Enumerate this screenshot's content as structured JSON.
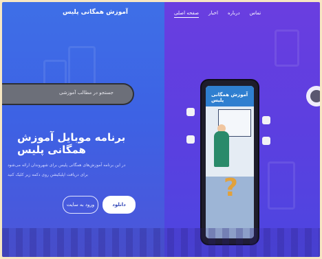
{
  "header": {
    "title": "آموزش همگانی پلیس"
  },
  "nav": {
    "items": [
      {
        "label": "صفحه اصلی",
        "active": true
      },
      {
        "label": "اخبار"
      },
      {
        "label": "درباره"
      },
      {
        "label": "تماس"
      }
    ]
  },
  "search": {
    "placeholder": "جستجو در مطالب آموزشی"
  },
  "hero": {
    "headline": "برنامه موبایل آموزش همگانی پلیس",
    "description_line1": "در این برنامه آموزش‌های همگانی پلیس برای شهروندان ارائه می‌شود",
    "description_line2": "برای دریافت اپلیکیشن روی دکمه زیر کلیک کنید",
    "primary_button": "دانلود",
    "secondary_button": "ورود به سایت"
  },
  "phone": {
    "screen_title": "آموزش همگانی پلیس"
  },
  "colors": {
    "left_bg": "#3d62e4",
    "right_bg": "#5c3fe0",
    "frame": "#f7e7c3"
  },
  "icons": [
    "phone-mockup",
    "app-icon",
    "arrow-next-icon"
  ]
}
